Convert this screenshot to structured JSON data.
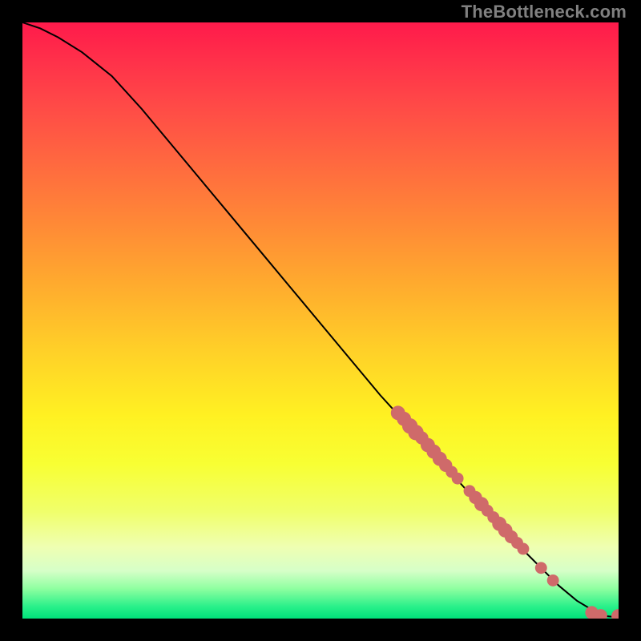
{
  "watermark": {
    "text": "TheBottleneck.com"
  },
  "colors": {
    "dot": "#cf6a6a",
    "curve": "#000000",
    "frame": "#000000"
  },
  "chart_data": {
    "type": "line",
    "title": "",
    "xlabel": "",
    "ylabel": "",
    "xlim": [
      0,
      100
    ],
    "ylim": [
      0,
      100
    ],
    "grid": false,
    "series": [
      {
        "name": "bottleneck-curve",
        "x": [
          0,
          3,
          6,
          10,
          15,
          20,
          25,
          30,
          35,
          40,
          45,
          50,
          55,
          60,
          65,
          70,
          75,
          80,
          85,
          90,
          93,
          96,
          98,
          100
        ],
        "y": [
          100,
          99,
          97.5,
          95,
          91,
          85.5,
          79.5,
          73.5,
          67.5,
          61.5,
          55.5,
          49.5,
          43.5,
          37.5,
          32,
          26.5,
          21,
          15.5,
          10.5,
          5.5,
          3,
          1.2,
          0.4,
          0.2
        ]
      }
    ],
    "points": [
      {
        "x": 63,
        "y": 34.5,
        "r": 1.2
      },
      {
        "x": 64,
        "y": 33.5,
        "r": 1.2
      },
      {
        "x": 65,
        "y": 32.3,
        "r": 1.3
      },
      {
        "x": 66,
        "y": 31.2,
        "r": 1.3
      },
      {
        "x": 67,
        "y": 30.3,
        "r": 1.1
      },
      {
        "x": 68,
        "y": 29.1,
        "r": 1.2
      },
      {
        "x": 69,
        "y": 28.0,
        "r": 1.2
      },
      {
        "x": 70,
        "y": 26.8,
        "r": 1.2
      },
      {
        "x": 71,
        "y": 25.7,
        "r": 1.1
      },
      {
        "x": 72,
        "y": 24.6,
        "r": 1.0
      },
      {
        "x": 73,
        "y": 23.5,
        "r": 1.0
      },
      {
        "x": 75,
        "y": 21.4,
        "r": 1.0
      },
      {
        "x": 76,
        "y": 20.3,
        "r": 1.1
      },
      {
        "x": 77,
        "y": 19.2,
        "r": 1.2
      },
      {
        "x": 78,
        "y": 18.1,
        "r": 1.0
      },
      {
        "x": 79,
        "y": 17.0,
        "r": 1.0
      },
      {
        "x": 80,
        "y": 15.9,
        "r": 1.2
      },
      {
        "x": 81,
        "y": 14.8,
        "r": 1.2
      },
      {
        "x": 82,
        "y": 13.7,
        "r": 1.1
      },
      {
        "x": 83,
        "y": 12.7,
        "r": 1.0
      },
      {
        "x": 84,
        "y": 11.7,
        "r": 1.0
      },
      {
        "x": 87,
        "y": 8.5,
        "r": 1.0
      },
      {
        "x": 89,
        "y": 6.4,
        "r": 1.0
      },
      {
        "x": 95.5,
        "y": 1.0,
        "r": 1.1
      },
      {
        "x": 97.0,
        "y": 0.5,
        "r": 1.1
      },
      {
        "x": 100,
        "y": 0.4,
        "r": 1.2
      }
    ]
  }
}
